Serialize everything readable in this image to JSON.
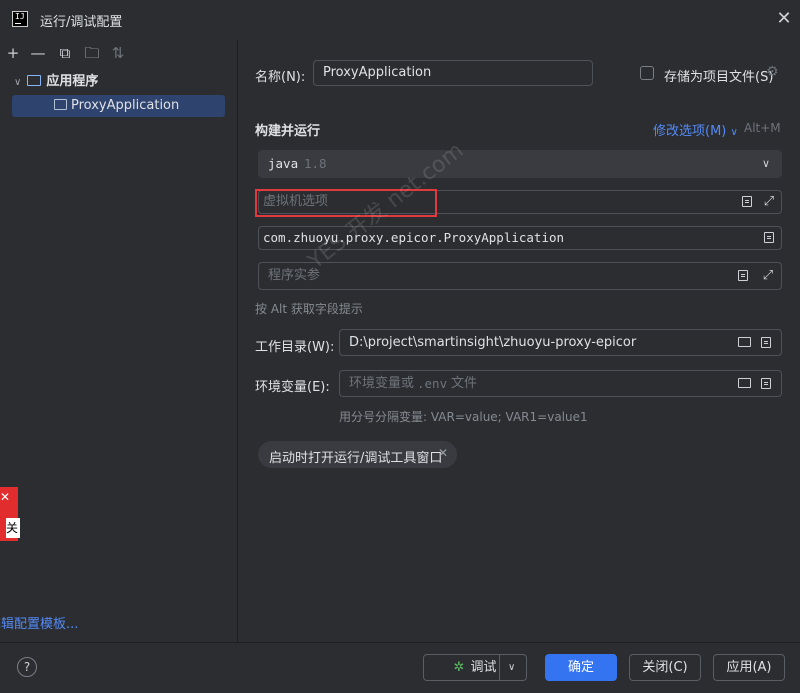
{
  "window": {
    "title": "运行/调试配置"
  },
  "sidebar": {
    "group_label": "应用程序",
    "item_label": "ProxyApplication",
    "edit_templates_label": "编辑配置模板...",
    "popup_text": "关"
  },
  "form": {
    "name_label": "名称(N):",
    "name_value": "ProxyApplication",
    "store_label": "存储为项目文件(S)",
    "build_section_label": "构建并运行",
    "modify_options_label": "修改选项(M)",
    "modify_shortcut": "Alt+M",
    "jdk_name": "java",
    "jdk_version": "1.8",
    "vm_options_placeholder": "虚拟机选项",
    "main_class_value": "com.zhuoyu.proxy.epicor.ProxyApplication",
    "program_args_placeholder": "程序实参",
    "alt_hint": "按 Alt 获取字段提示",
    "workdir_label": "工作目录(W):",
    "workdir_value": "D:\\project\\smartinsight\\zhuoyu-proxy-epicor",
    "env_label": "环境变量(E):",
    "env_placeholder_a": "环境变量或",
    "env_placeholder_b": ".env",
    "env_placeholder_c": "文件",
    "env_hint": "用分号分隔变量: VAR=value; VAR1=value1",
    "chip_label": "启动时打开运行/调试工具窗口"
  },
  "footer": {
    "debug_label": "调试",
    "ok_label": "确定",
    "close_label": "关闭(C)",
    "apply_label": "应用(A)",
    "help_label": "?"
  },
  "watermark": {
    "text": "YES 开发 net.com"
  },
  "colors": {
    "accent": "#3574f0",
    "link": "#548af7",
    "highlight_box": "#e0393e",
    "background": "#2b2d30"
  }
}
